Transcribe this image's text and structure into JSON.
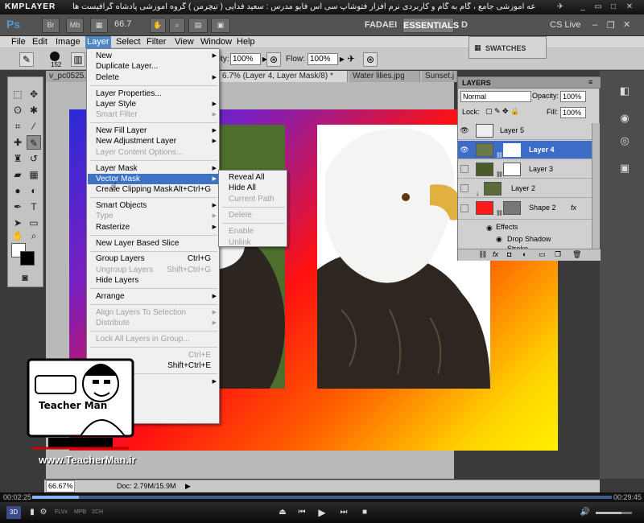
{
  "player": {
    "logo": "KMPLAYER",
    "title": "مجموعه آموزشی جامع ، گام به گام و کاربردی نرم افزار فتوشاپ سی اس فایو مدرس : سعید فدایی ( تیچرمن ) گروه آموزشی پادشاه گرافیست ها",
    "time_elapsed": "00:02:25",
    "time_total": "00:29:45",
    "progress_fraction": 0.08,
    "badges": [
      "FLVx",
      "MPB",
      "2CH"
    ]
  },
  "appbar": {
    "logo": "Ps",
    "br_label": "Br",
    "mb_label": "Mb",
    "zoom": "66.7",
    "user": "FADAEI",
    "workspace_active": "ESSENTIALS",
    "workspace_next": "D",
    "cslive": "CS Live"
  },
  "menubar": {
    "items": [
      "File",
      "Edit",
      "Image",
      "Layer",
      "Select",
      "Filter",
      "View",
      "Window",
      "Help"
    ],
    "open": "Layer"
  },
  "options": {
    "brush_size": "152",
    "opacity_label": "Opacity:",
    "opacity": "100%",
    "flow_label": "Flow:",
    "flow": "100%"
  },
  "tabs": [
    "v_pc0525.",
    "6.7% (Layer 4, Layer Mask/8) *",
    "Water lilies.jpg",
    "Sunset.j"
  ],
  "layer_menu": {
    "groups": [
      [
        {
          "label": "New",
          "submenu": true
        },
        {
          "label": "Duplicate Layer..."
        },
        {
          "label": "Delete",
          "submenu": true
        }
      ],
      [
        {
          "label": "Layer Properties..."
        },
        {
          "label": "Layer Style",
          "submenu": true
        },
        {
          "label": "Smart Filter",
          "disabled": true,
          "submenu": true
        }
      ],
      [
        {
          "label": "New Fill Layer",
          "submenu": true
        },
        {
          "label": "New Adjustment Layer",
          "submenu": true
        },
        {
          "label": "Layer Content Options...",
          "disabled": true
        }
      ],
      [
        {
          "label": "Layer Mask",
          "submenu": true
        },
        {
          "label": "Vector Mask",
          "submenu": true,
          "highlighted": true
        },
        {
          "label": "Create Clipping Mask",
          "shortcut": "Alt+Ctrl+G"
        }
      ],
      [
        {
          "label": "Smart Objects",
          "submenu": true
        },
        {
          "label": "Type",
          "disabled": true,
          "submenu": true
        },
        {
          "label": "Rasterize",
          "submenu": true
        }
      ],
      [
        {
          "label": "New Layer Based Slice"
        }
      ],
      [
        {
          "label": "Group Layers",
          "shortcut": "Ctrl+G"
        },
        {
          "label": "Ungroup Layers",
          "shortcut": "Shift+Ctrl+G",
          "disabled": true
        },
        {
          "label": "Hide Layers"
        }
      ],
      [
        {
          "label": "Arrange",
          "submenu": true
        }
      ],
      [
        {
          "label": "Align Layers To Selection",
          "disabled": true,
          "submenu": true
        },
        {
          "label": "Distribute",
          "disabled": true,
          "submenu": true
        }
      ],
      [
        {
          "label": "Lock All Layers in Group...",
          "disabled": true
        }
      ],
      [
        {
          "label": "",
          "shortcut": "Ctrl+E",
          "disabled": true
        },
        {
          "label": "",
          "shortcut": "Shift+Ctrl+E"
        }
      ],
      [
        {
          "label": "",
          "submenu": true
        }
      ]
    ]
  },
  "vector_mask_submenu": {
    "groups": [
      [
        {
          "label": "Reveal All"
        },
        {
          "label": "Hide All"
        },
        {
          "label": "Current Path",
          "disabled": true
        }
      ],
      [
        {
          "label": "Delete",
          "disabled": true
        }
      ],
      [
        {
          "label": "Enable",
          "disabled": true
        },
        {
          "label": "Unlink",
          "disabled": true
        }
      ]
    ]
  },
  "swatches": {
    "title": "SWATCHES"
  },
  "layers_panel": {
    "title": "LAYERS",
    "blend_mode": "Normal",
    "opacity_label": "Opacity:",
    "opacity": "100%",
    "lock_label": "Lock:",
    "fill_label": "Fill:",
    "fill": "100%",
    "layers": [
      {
        "name": "Layer 5",
        "visible": true,
        "selected": false
      },
      {
        "name": "Layer 4",
        "visible": true,
        "selected": true
      },
      {
        "name": "Layer 3",
        "visible": false,
        "selected": false
      },
      {
        "name": "Layer 2",
        "visible": false,
        "selected": false
      },
      {
        "name": "Shape 2",
        "visible": false,
        "selected": false
      }
    ],
    "effects_label": "Effects",
    "effect": "Drop Shadow",
    "effect_partial": "Stroke"
  },
  "status": {
    "zoom": "66.67%",
    "doc": "Doc: 2.79M/15.9M"
  },
  "watermark": {
    "brand": "Teacher Man",
    "url": "www.TeacherMan.ir"
  },
  "colors": {
    "menu_highlight": "#3e72c4",
    "layer_selected": "#3b6cc8",
    "app_bg": "#535353"
  }
}
